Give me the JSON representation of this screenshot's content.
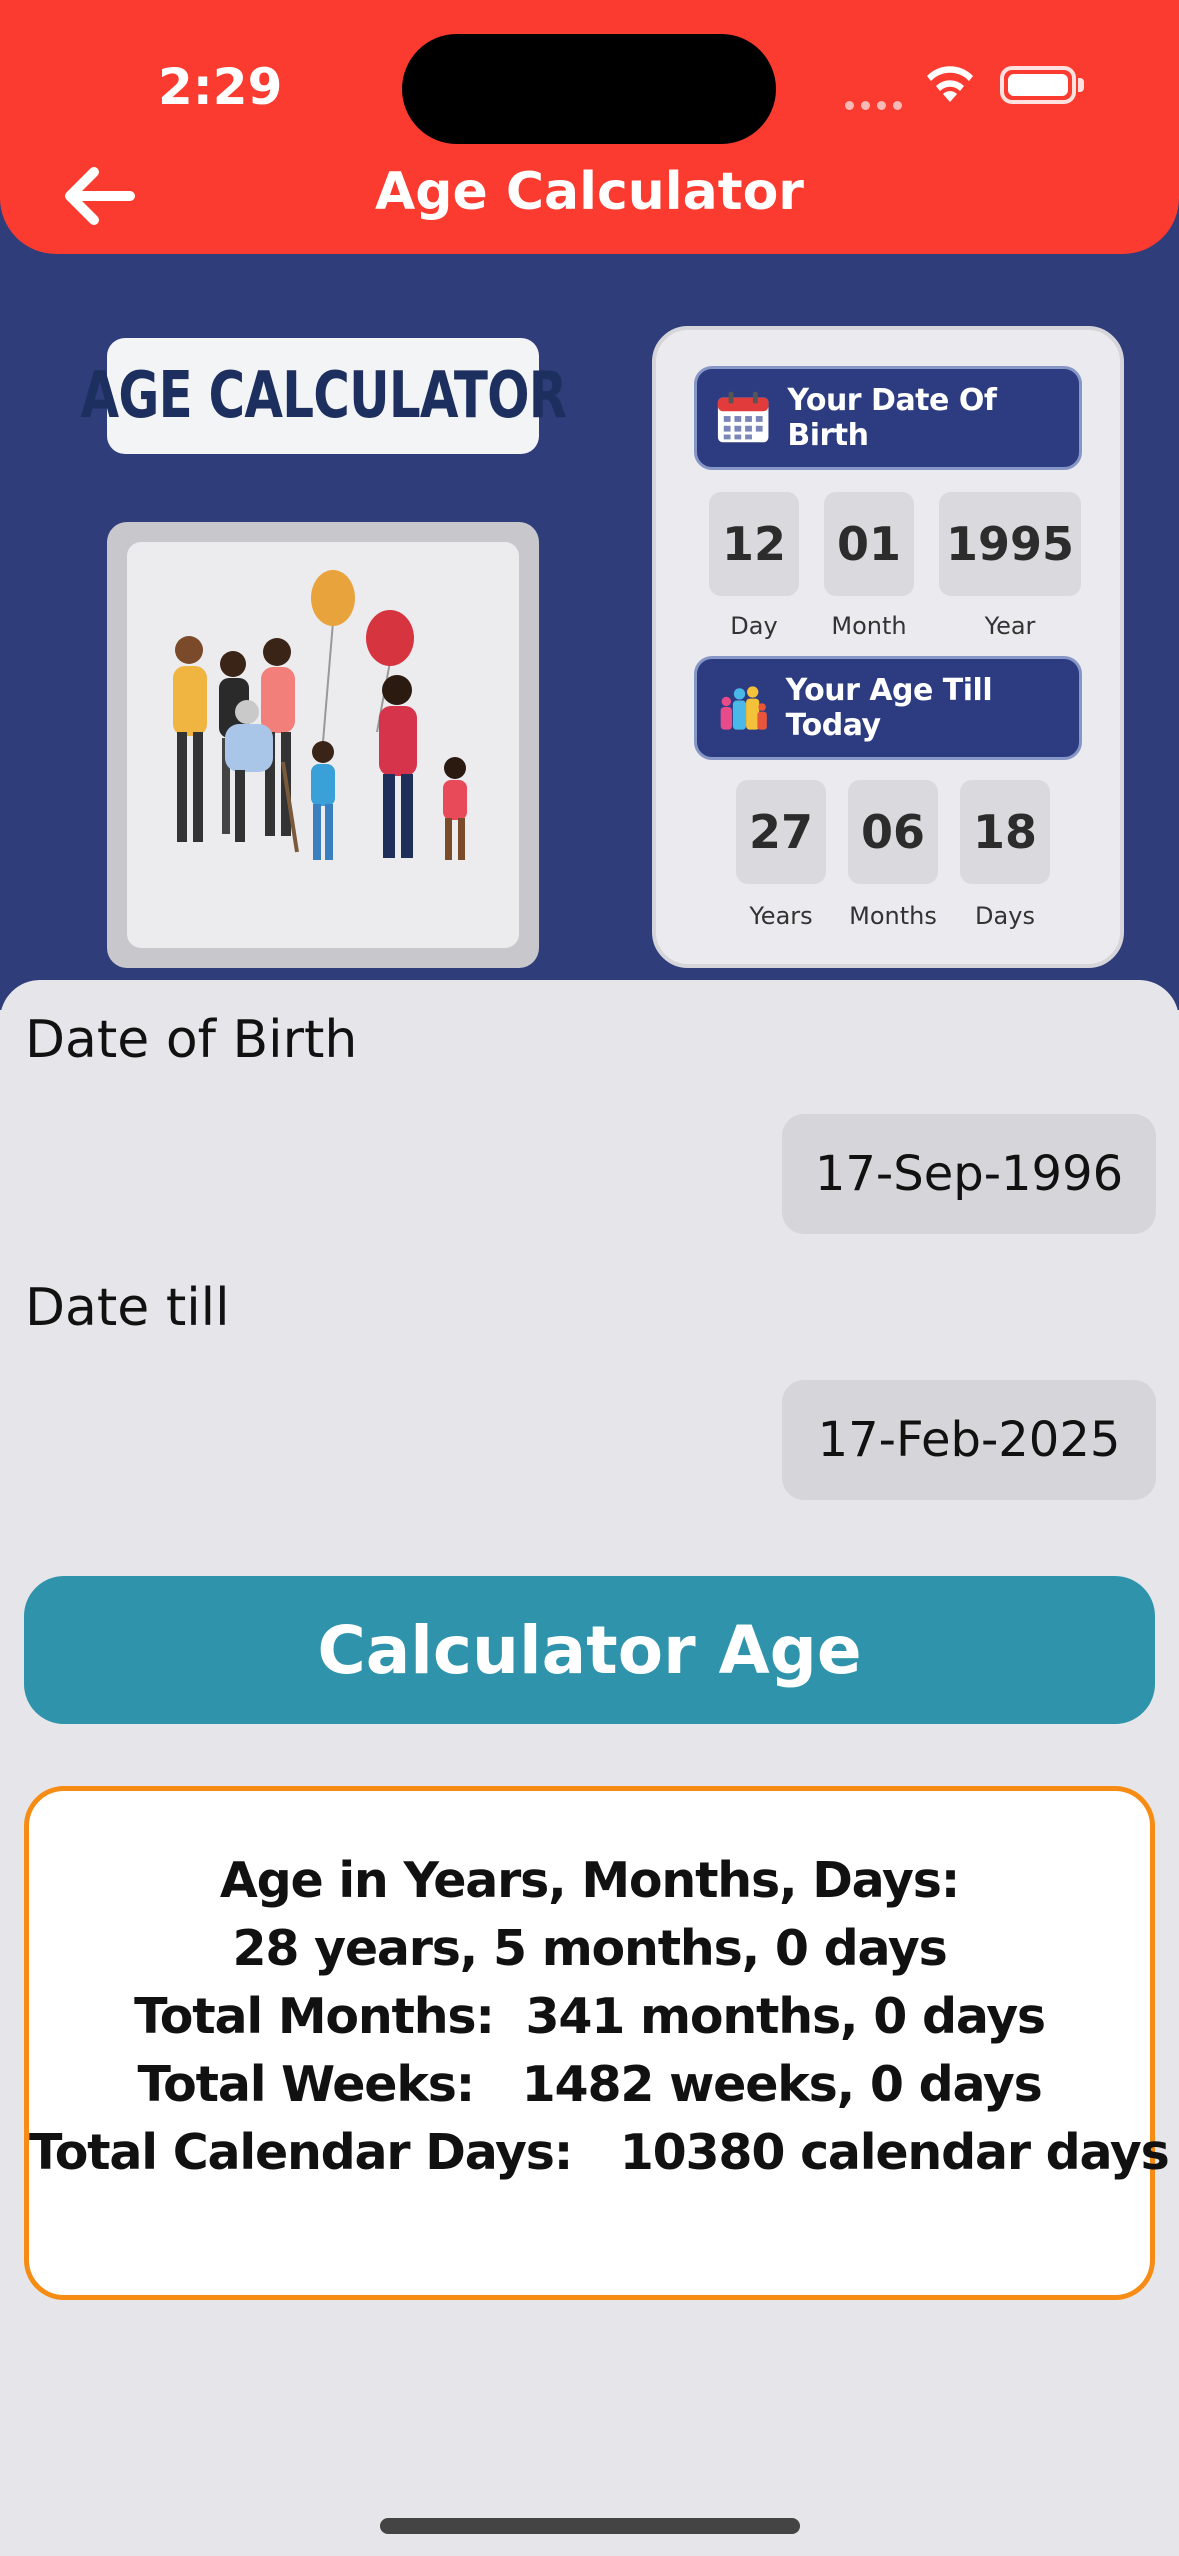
{
  "status_bar": {
    "time": "2:29"
  },
  "nav": {
    "title": "Age Calculator",
    "back_icon": "arrow-left-icon"
  },
  "banner": {
    "brand_label": "AGE CALCULATOR",
    "illustration_icon": "family-illustration",
    "card": {
      "dob_title": "Your Date Of Birth",
      "dob_icon": "calendar-icon",
      "dob_values": [
        {
          "value": "12",
          "label": "Day"
        },
        {
          "value": "01",
          "label": "Month"
        },
        {
          "value": "1995",
          "label": "Year"
        }
      ],
      "age_title": "Your Age Till Today",
      "age_icon": "people-icon",
      "age_values": [
        {
          "value": "27",
          "label": "Years"
        },
        {
          "value": "06",
          "label": "Months"
        },
        {
          "value": "18",
          "label": "Days"
        }
      ]
    }
  },
  "form": {
    "dob_label": "Date of Birth",
    "dob_value": "17-Sep-1996",
    "till_label": "Date till",
    "till_value": "17-Feb-2025",
    "calc_button": "Calculator Age"
  },
  "result": {
    "lines": [
      "Age in Years, Months, Days:",
      "28 years, 5 months, 0 days",
      "Total Months:  341 months, 0 days",
      "Total Weeks:   1482 weeks, 0 days",
      "Total Calendar Days:   10380 calendar days"
    ]
  },
  "colors": {
    "header": "#fb3b30",
    "banner": "#2f3d7b",
    "button": "#2e93ab",
    "result_border": "#f68c14"
  }
}
